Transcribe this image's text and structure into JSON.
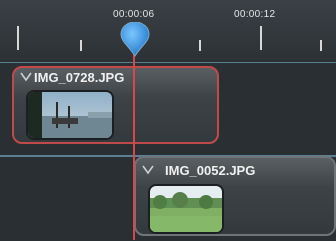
{
  "timeline": {
    "timecodes": [
      "00:00:06",
      "00:00:12"
    ]
  },
  "clips": [
    {
      "name": "IMG_0728.JPG"
    },
    {
      "name": "IMG_0052.JPG"
    }
  ],
  "colors": {
    "playhead": "#d24a4a",
    "playhead_knob": "#3a9fe0",
    "selected_clip_border": "#c04a4a"
  }
}
